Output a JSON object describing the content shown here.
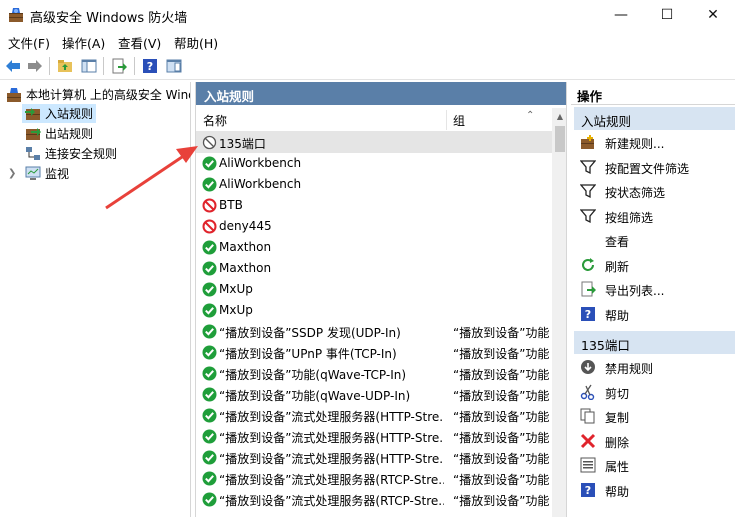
{
  "window": {
    "title": "高级安全 Windows 防火墙",
    "minimize": "—",
    "maximize": "☐",
    "close": "✕"
  },
  "menu": [
    "文件(F)",
    "操作(A)",
    "查看(V)",
    "帮助(H)"
  ],
  "tree": {
    "root": "本地计算机 上的高级安全 Windows",
    "items": [
      "入站规则",
      "出站规则",
      "连接安全规则",
      "监视"
    ]
  },
  "middle": {
    "header": "入站规则",
    "col_name": "名称",
    "col_group": "组",
    "rows": [
      {
        "name": "135端口",
        "group": "",
        "status": "disabled"
      },
      {
        "name": "AliWorkbench",
        "group": "",
        "status": "allow"
      },
      {
        "name": "AliWorkbench",
        "group": "",
        "status": "allow"
      },
      {
        "name": "BTB",
        "group": "",
        "status": "block"
      },
      {
        "name": "deny445",
        "group": "",
        "status": "block"
      },
      {
        "name": "Maxthon",
        "group": "",
        "status": "allow"
      },
      {
        "name": "Maxthon",
        "group": "",
        "status": "allow"
      },
      {
        "name": "MxUp",
        "group": "",
        "status": "allow"
      },
      {
        "name": "MxUp",
        "group": "",
        "status": "allow"
      },
      {
        "name": "“播放到设备”SSDP 发现(UDP-In)",
        "group": "“播放到设备”功能",
        "status": "allow"
      },
      {
        "name": "“播放到设备”UPnP 事件(TCP-In)",
        "group": "“播放到设备”功能",
        "status": "allow"
      },
      {
        "name": "“播放到设备”功能(qWave-TCP-In)",
        "group": "“播放到设备”功能",
        "status": "allow"
      },
      {
        "name": "“播放到设备”功能(qWave-UDP-In)",
        "group": "“播放到设备”功能",
        "status": "allow"
      },
      {
        "name": "“播放到设备”流式处理服务器(HTTP-Stre...",
        "group": "“播放到设备”功能",
        "status": "allow"
      },
      {
        "name": "“播放到设备”流式处理服务器(HTTP-Stre...",
        "group": "“播放到设备”功能",
        "status": "allow"
      },
      {
        "name": "“播放到设备”流式处理服务器(HTTP-Stre...",
        "group": "“播放到设备”功能",
        "status": "allow"
      },
      {
        "name": "“播放到设备”流式处理服务器(RTCP-Stre...",
        "group": "“播放到设备”功能",
        "status": "allow"
      },
      {
        "name": "“播放到设备”流式处理服务器(RTCP-Stre...",
        "group": "“播放到设备”功能",
        "status": "allow"
      }
    ]
  },
  "actions": {
    "title": "操作",
    "section1": "入站规则",
    "section1_items": [
      {
        "label": "新建规则...",
        "icon": "new-rule-icon"
      },
      {
        "label": "按配置文件筛选",
        "icon": "filter-icon"
      },
      {
        "label": "按状态筛选",
        "icon": "filter-icon"
      },
      {
        "label": "按组筛选",
        "icon": "filter-icon"
      },
      {
        "label": "查看",
        "icon": "none"
      },
      {
        "label": "刷新",
        "icon": "refresh-icon"
      },
      {
        "label": "导出列表...",
        "icon": "export-icon"
      },
      {
        "label": "帮助",
        "icon": "help-icon"
      }
    ],
    "section2": "135端口",
    "section2_items": [
      {
        "label": "禁用规则",
        "icon": "disable-icon"
      },
      {
        "label": "剪切",
        "icon": "cut-icon"
      },
      {
        "label": "复制",
        "icon": "copy-icon"
      },
      {
        "label": "删除",
        "icon": "delete-icon"
      },
      {
        "label": "属性",
        "icon": "properties-icon"
      },
      {
        "label": "帮助",
        "icon": "help-icon"
      }
    ]
  },
  "colors": {
    "header_blue": "#5a7fa8",
    "section_blue": "#d7e4f2",
    "allow_green": "#1f9e3a",
    "block_red": "#e0242c",
    "arrow_red": "#e8413a"
  }
}
